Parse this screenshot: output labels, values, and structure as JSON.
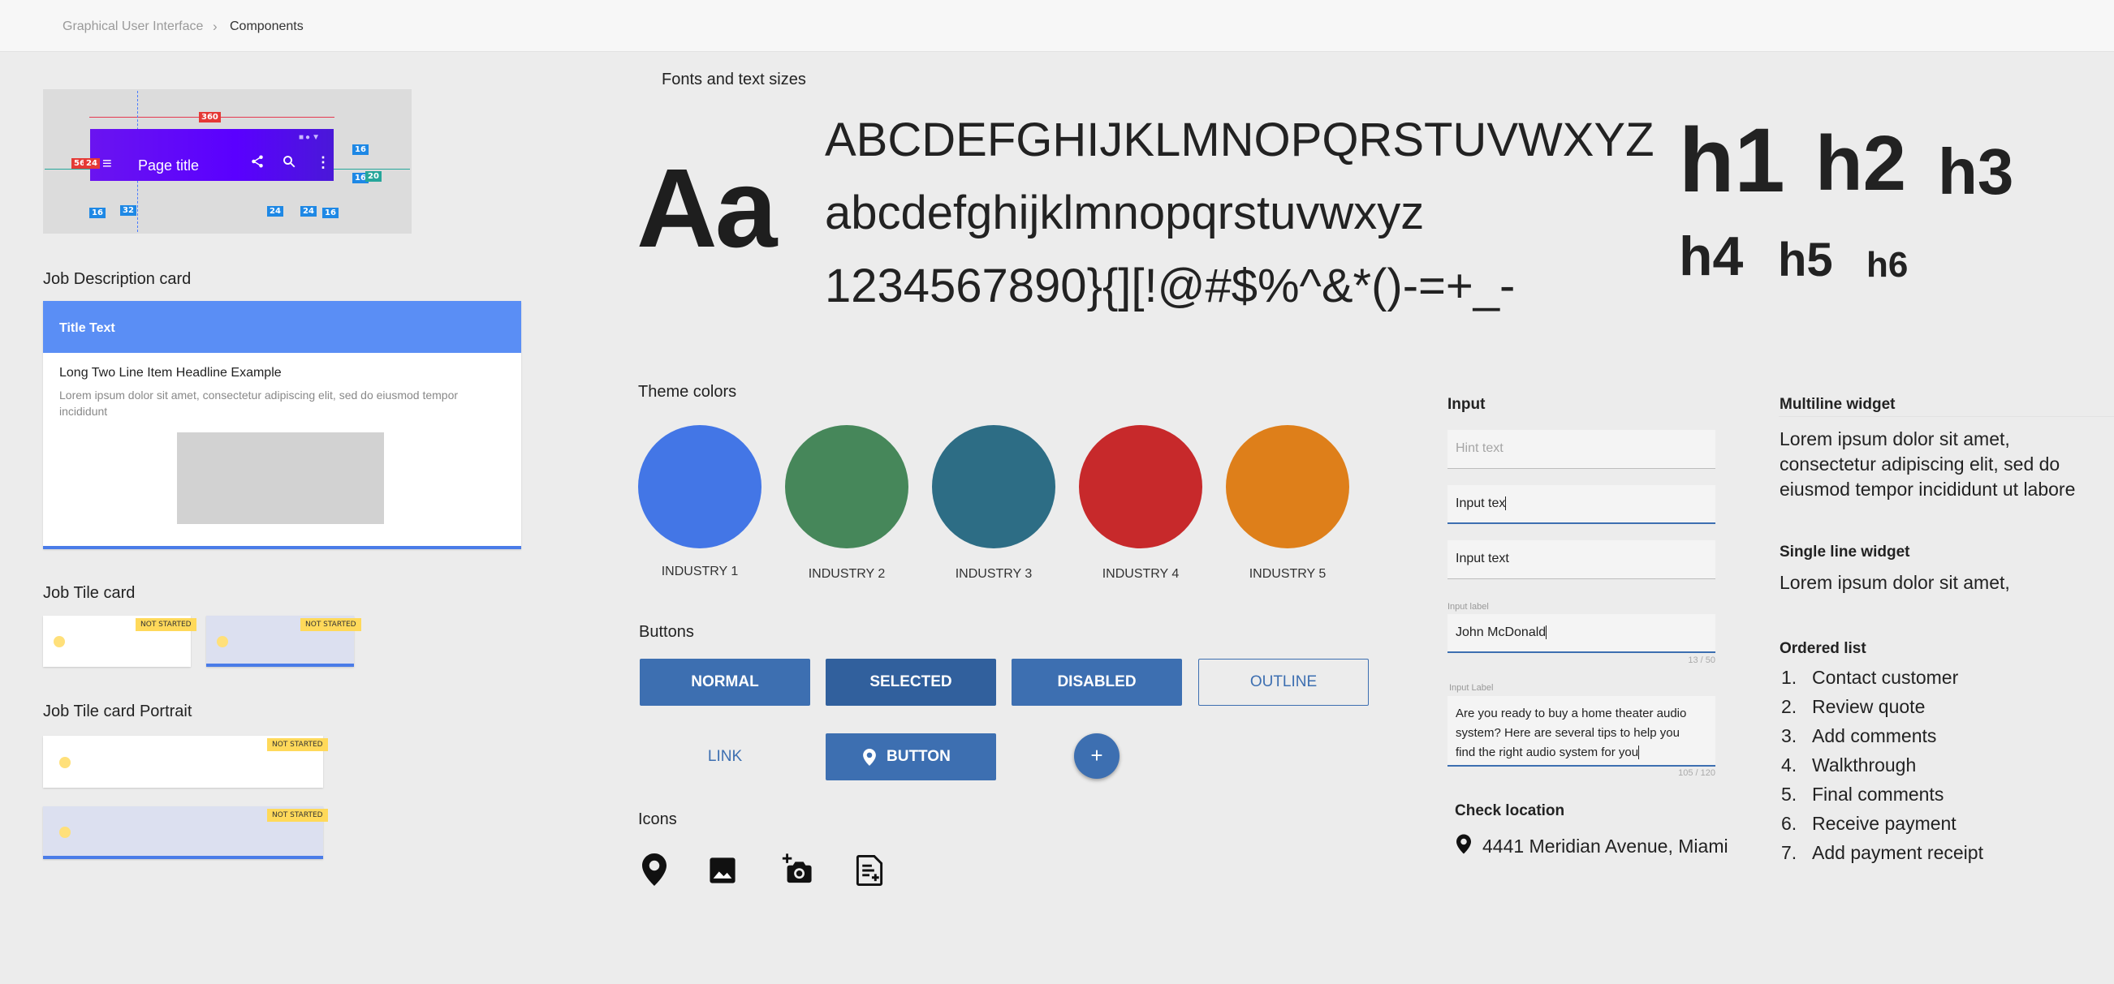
{
  "breadcrumb": {
    "parent": "Graphical User Interface",
    "separator": "›",
    "current": "Components"
  },
  "appbar_spec": {
    "title": "Page title",
    "tags": {
      "width": "360",
      "h56": "56",
      "h24": "24",
      "w16a": "16",
      "w32": "32",
      "w24a": "24",
      "w24b": "24",
      "w16b": "16",
      "r16a": "16",
      "r16b": "16",
      "r20": "20"
    }
  },
  "job_description": {
    "heading": "Job Description card",
    "title_text": "Title Text",
    "headline": "Long Two Line Item Headline Example",
    "body": "Lorem ipsum dolor sit amet, consectetur adipiscing elit, sed do eiusmod tempor incididunt"
  },
  "job_tile": {
    "heading": "Job Tile card",
    "badge": "NOT STARTED"
  },
  "job_tile_portrait": {
    "heading": "Job Tile card Portrait",
    "badge": "NOT STARTED"
  },
  "fonts": {
    "heading": "Fonts and text sizes",
    "sample": "Aa",
    "uppercase": "ABCDEFGHIJKLMNOPQRSTUVWXYZ",
    "lowercase": "abcdefghijklmnopqrstuvwxyz",
    "symbols": "1234567890}{][!@#$%^&*()-=+_-",
    "headings": [
      "h1",
      "h2",
      "h3",
      "h4",
      "h5",
      "h6"
    ]
  },
  "theme": {
    "heading": "Theme colors",
    "swatches": [
      {
        "label": "INDUSTRY 1",
        "color": "#4376e6"
      },
      {
        "label": "INDUSTRY 2",
        "color": "#46875a"
      },
      {
        "label": "INDUSTRY 3",
        "color": "#2d6d85"
      },
      {
        "label": "INDUSTRY 4",
        "color": "#c7292b"
      },
      {
        "label": "INDUSTRY 5",
        "color": "#de7f1a"
      }
    ]
  },
  "buttons": {
    "heading": "Buttons",
    "normal": "NORMAL",
    "selected": "SELECTED",
    "disabled": "DISABLED",
    "outline": "OUTLINE",
    "link": "LINK",
    "icon_button": "BUTTON",
    "fab": "+"
  },
  "icons": {
    "heading": "Icons",
    "items": [
      "location-pin-icon",
      "image-icon",
      "add-photo-icon",
      "note-add-icon"
    ]
  },
  "input": {
    "heading": "Input",
    "hint": "Hint text",
    "active_value": "Input tex",
    "value": "Input text",
    "labeled": {
      "label": "Input label",
      "value": "John McDonald",
      "counter": "13 / 50"
    },
    "multiline": {
      "label": "Input Label",
      "lines": [
        "Are you ready to buy a home theater audio",
        "system? Here are several tips to help you",
        "find the right audio system for you"
      ],
      "counter": "105 / 120"
    }
  },
  "location": {
    "heading": "Check location",
    "address": "4441 Meridian Avenue, Miami"
  },
  "multiline_widget": {
    "heading": "Multiline widget",
    "lines": [
      "Lorem ipsum dolor sit amet,",
      "consectetur adipiscing elit, sed do",
      "eiusmod tempor incididunt ut labore"
    ]
  },
  "single_line_widget": {
    "heading": "Single line widget",
    "text": "Lorem ipsum dolor sit amet,"
  },
  "ordered_list": {
    "heading": "Ordered list",
    "items": [
      {
        "num": "1.",
        "text": "Contact customer"
      },
      {
        "num": "2.",
        "text": "Review quote"
      },
      {
        "num": "3.",
        "text": "Add comments"
      },
      {
        "num": "4.",
        "text": "Walkthrough"
      },
      {
        "num": "5.",
        "text": "Final comments"
      },
      {
        "num": "6.",
        "text": "Receive payment"
      },
      {
        "num": "7.",
        "text": "Add payment receipt"
      }
    ]
  }
}
